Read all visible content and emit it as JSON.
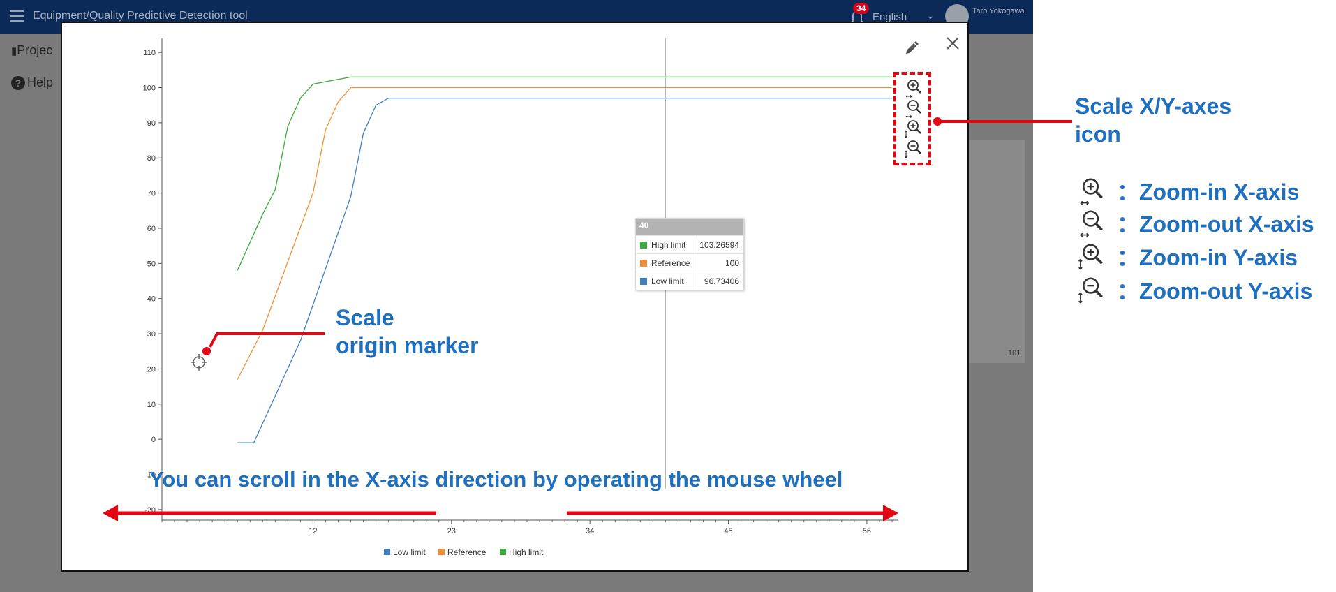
{
  "app": {
    "title": "Equipment/Quality Predictive Detection tool",
    "notification_count": "34",
    "language": "English",
    "user_name": "Taro Yokogawa",
    "sidebar_projects": "Projec",
    "sidebar_help": "Help",
    "background_tick": "101"
  },
  "colors": {
    "low_limit": "#3f7fbf",
    "reference": "#f0913a",
    "high_limit": "#3caa3c",
    "annotation_blue": "#1f6fc0",
    "annotation_red": "#e30613"
  },
  "icons": [
    "pencil-icon",
    "close-icon",
    "zoom-in-x-icon",
    "zoom-out-x-icon",
    "zoom-in-y-icon",
    "zoom-out-y-icon",
    "crosshair-icon"
  ],
  "chart_data": {
    "type": "line",
    "title": "",
    "xlabel": "",
    "ylabel": "",
    "xlim": [
      0,
      58.5
    ],
    "ylim": [
      -23,
      114
    ],
    "yticks": [
      110,
      100,
      90,
      80,
      70,
      60,
      50,
      40,
      30,
      20,
      10,
      0,
      -10,
      -20
    ],
    "xticks": [
      12,
      23,
      34,
      45,
      56
    ],
    "legend_position": "bottom-center",
    "grid": false,
    "series": [
      {
        "name": "Low limit",
        "color": "#3f7fbf",
        "x": [
          6,
          7.3,
          11,
          15,
          16,
          17,
          18,
          58
        ],
        "y": [
          -1,
          -1,
          28,
          69,
          87,
          95,
          97,
          97
        ]
      },
      {
        "name": "Reference",
        "color": "#f0913a",
        "x": [
          6,
          8,
          12,
          13,
          14,
          15,
          58
        ],
        "y": [
          17,
          31,
          70,
          88,
          96,
          100,
          100
        ]
      },
      {
        "name": "High limit",
        "color": "#3caa3c",
        "x": [
          6,
          8,
          9,
          10,
          11,
          12,
          15,
          58
        ],
        "y": [
          48,
          64,
          71,
          89,
          97,
          101,
          103,
          103
        ]
      }
    ],
    "cursor_x": 40,
    "tooltip": {
      "header": "40",
      "rows": [
        {
          "name": "High limit",
          "value": "103.26594",
          "color": "#3caa3c"
        },
        {
          "name": "Reference",
          "value": "100",
          "color": "#f0913a"
        },
        {
          "name": "Low limit",
          "value": "96.73406",
          "color": "#3f7fbf"
        }
      ]
    }
  },
  "annotations": {
    "axes_icon_label_line1": "Scale X/Y-axes",
    "axes_icon_label_line2": "icon",
    "origin_label_line1": "Scale",
    "origin_label_line2": "origin marker",
    "scroll_label": "You can scroll in the X-axis direction by operating the mouse wheel",
    "legend": [
      {
        "icon": "zoom-in-x-icon",
        "text": "：Zoom-in X-axis"
      },
      {
        "icon": "zoom-out-x-icon",
        "text": "：Zoom-out X-axis"
      },
      {
        "icon": "zoom-in-y-icon",
        "text": "：Zoom-in Y-axis"
      },
      {
        "icon": "zoom-out-y-icon",
        "text": "：Zoom-out Y-axis"
      }
    ]
  }
}
